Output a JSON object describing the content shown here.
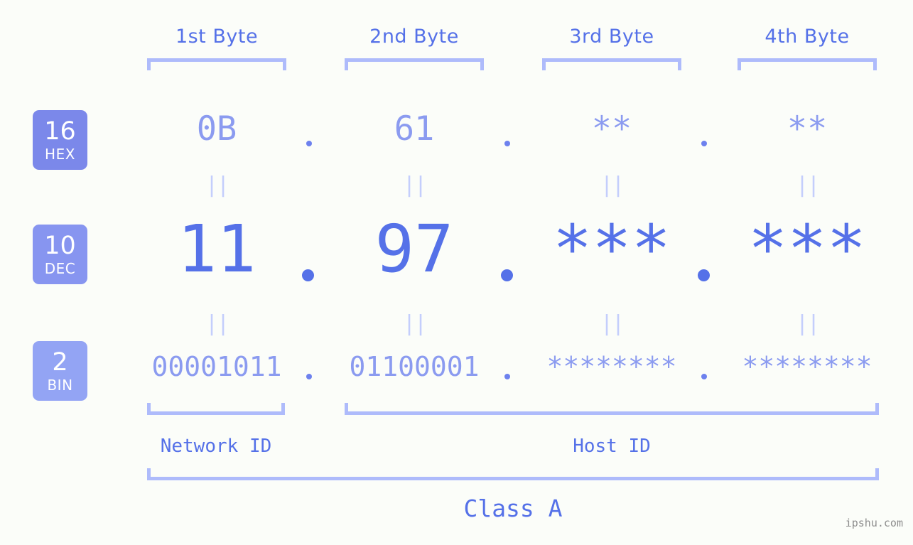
{
  "headers": [
    {
      "label": "1st Byte"
    },
    {
      "label": "2nd Byte"
    },
    {
      "label": "3rd Byte"
    },
    {
      "label": "4th Byte"
    }
  ],
  "radix_badges": [
    {
      "number": "16",
      "name": "HEX",
      "color": "#7b88ea"
    },
    {
      "number": "10",
      "name": "DEC",
      "color": "#8795f0"
    },
    {
      "number": "2",
      "name": "BIN",
      "color": "#93a4f4"
    }
  ],
  "rows": {
    "hex": {
      "values": [
        "0B",
        "61",
        "**",
        "**"
      ]
    },
    "dec": {
      "values": [
        "11",
        "97",
        "***",
        "***"
      ]
    },
    "bin": {
      "values": [
        "00001011",
        "01100001",
        "********",
        "********"
      ]
    }
  },
  "separator": ".",
  "equals_mark": "||",
  "sections": [
    {
      "label": "Network ID"
    },
    {
      "label": "Host ID"
    }
  ],
  "class_label": "Class A",
  "watermark": "ipshu.com",
  "colors": {
    "background": "#fbfdf9",
    "accent": "#5571e8",
    "accent_light": "#8b9bf0",
    "bracket": "#aebbfb",
    "connector": "#c4cefc",
    "watermark": "#8d8d8d"
  }
}
